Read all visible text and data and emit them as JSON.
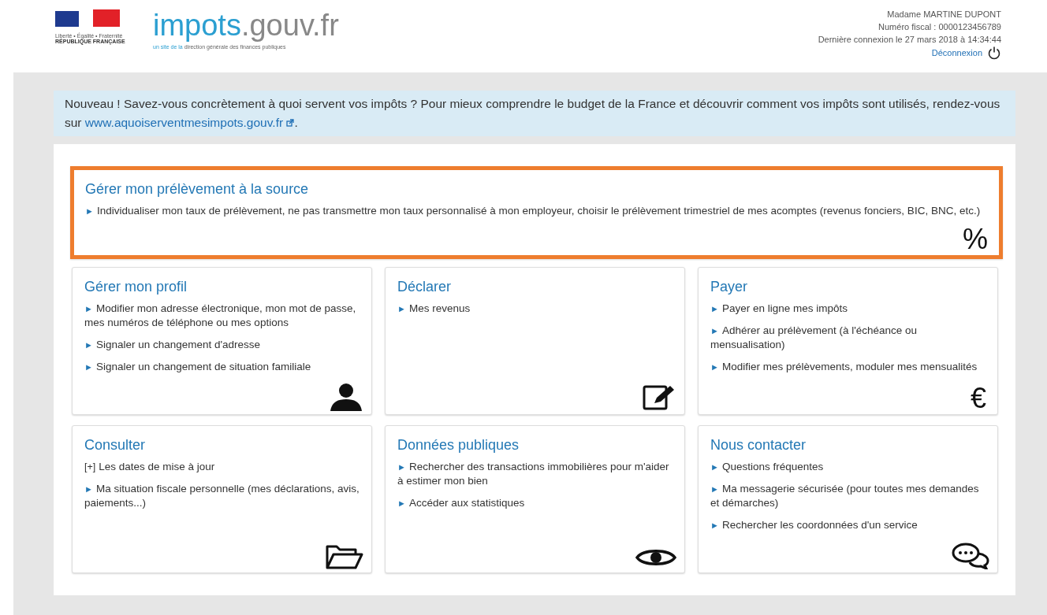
{
  "header": {
    "logo": {
      "motto": "Liberté • Égalité • Fraternité",
      "republic": "RÉPUBLIQUE FRANÇAISE"
    },
    "brand": {
      "name": "impots",
      "domain": ".gouv.fr",
      "tagline_lead": "un site de la",
      "tagline": "direction générale des finances publiques"
    },
    "user": {
      "name": "Madame MARTINE DUPONT",
      "fiscal_number": "Numéro fiscal : 0000123456789",
      "last_login": "Dernière connexion le 27 mars 2018 à 14:34:44",
      "logout": "Déconnexion"
    }
  },
  "banner": {
    "text": "Nouveau ! Savez-vous concrètement à quoi servent vos impôts ? Pour mieux comprendre le budget de la France et découvrir comment vos impôts sont utilisés, rendez-vous sur",
    "link": "www.aquoiserventmesimpots.gouv.fr",
    "end": "."
  },
  "featured": {
    "title": "Gérer mon prélèvement à la source",
    "highlighted": true,
    "icon": {
      "kind": "glyph",
      "text": "%"
    },
    "links": [
      {
        "marker": "►",
        "text": "Individualiser mon taux de prélèvement, ne pas transmettre mon taux personnalisé à mon employeur, choisir le prélèvement trimestriel de mes acomptes (revenus fonciers, BIC, BNC, etc.)"
      }
    ]
  },
  "cards": [
    {
      "title": "Gérer mon profil",
      "icon": {
        "kind": "person"
      },
      "links": [
        {
          "marker": "►",
          "text": "Modifier mon adresse électronique, mon mot de passe, mes numéros de téléphone ou mes options"
        },
        {
          "marker": "►",
          "text": "Signaler un changement d'adresse"
        },
        {
          "marker": "►",
          "text": "Signaler un changement de situation familiale"
        }
      ]
    },
    {
      "title": "Déclarer",
      "icon": {
        "kind": "edit"
      },
      "links": [
        {
          "marker": "►",
          "text": "Mes revenus"
        }
      ]
    },
    {
      "title": "Payer",
      "icon": {
        "kind": "glyph",
        "text": "€"
      },
      "links": [
        {
          "marker": "►",
          "text": "Payer en ligne mes impôts"
        },
        {
          "marker": "►",
          "text": "Adhérer au prélèvement (à l'échéance ou mensualisation)"
        },
        {
          "marker": "►",
          "text": "Modifier mes prélèvements, moduler mes mensualités"
        }
      ]
    },
    {
      "title": "Consulter",
      "icon": {
        "kind": "folder"
      },
      "links": [
        {
          "marker": "[+]",
          "text": "Les dates de mise à jour"
        },
        {
          "marker": "►",
          "text": "Ma situation fiscale personnelle (mes déclarations, avis, paiements...)"
        }
      ]
    },
    {
      "title": "Données publiques",
      "icon": {
        "kind": "eye"
      },
      "links": [
        {
          "marker": "►",
          "text": "Rechercher des transactions immobilières pour m'aider à estimer mon bien"
        },
        {
          "marker": "►",
          "text": "Accéder aux statistiques"
        }
      ]
    },
    {
      "title": "Nous contacter",
      "icon": {
        "kind": "chat"
      },
      "links": [
        {
          "marker": "►",
          "text": "Questions fréquentes"
        },
        {
          "marker": "►",
          "text": "Ma messagerie sécurisée (pour toutes mes demandes et démarches)"
        },
        {
          "marker": "►",
          "text": "Rechercher les coordonnées d'un service"
        }
      ]
    }
  ]
}
